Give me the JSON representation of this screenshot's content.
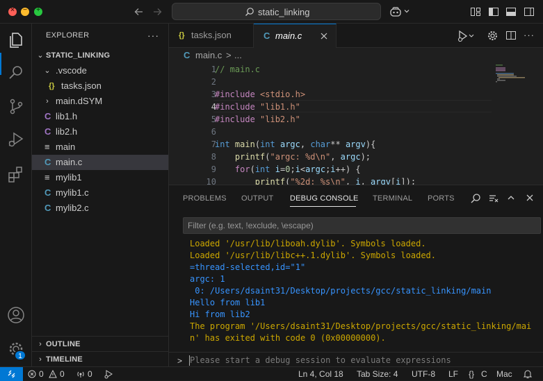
{
  "titlebar": {
    "search_text": "static_linking"
  },
  "sidebar": {
    "title": "EXPLORER",
    "more": "···",
    "workspace": "STATIC_LINKING",
    "tree": [
      {
        "label": ".vscode",
        "type": "folder-open",
        "icon": ""
      },
      {
        "label": "tasks.json",
        "type": "json",
        "icon": "{}"
      },
      {
        "label": "main.dSYM",
        "type": "folder",
        "icon": ""
      },
      {
        "label": "lib1.h",
        "type": "c",
        "icon": "C"
      },
      {
        "label": "lib2.h",
        "type": "c",
        "icon": "C"
      },
      {
        "label": "main",
        "type": "text",
        "icon": "≡"
      },
      {
        "label": "main.c",
        "type": "c",
        "icon": "C",
        "selected": true
      },
      {
        "label": "mylib1",
        "type": "text",
        "icon": "≡"
      },
      {
        "label": "mylib1.c",
        "type": "c",
        "icon": "C"
      },
      {
        "label": "mylib2.c",
        "type": "c",
        "icon": "C"
      }
    ],
    "outline": "OUTLINE",
    "timeline": "TIMELINE"
  },
  "activity": {
    "badge": "1"
  },
  "tabs": [
    {
      "label": "tasks.json",
      "icon": "{}",
      "active": false
    },
    {
      "label": "main.c",
      "icon": "C",
      "active": true
    }
  ],
  "breadcrumb": {
    "file": "main.c",
    "sep": ">",
    "more": "..."
  },
  "editor": {
    "line_numbers": [
      "1",
      "2",
      "3",
      "4",
      "5",
      "6",
      "7",
      "8",
      "9",
      "10"
    ],
    "current_line": "4"
  },
  "panel": {
    "tabs": [
      "PROBLEMS",
      "OUTPUT",
      "DEBUG CONSOLE",
      "TERMINAL",
      "PORTS"
    ],
    "active_tab": "DEBUG CONSOLE",
    "filter_placeholder": "Filter (e.g. text, !exclude, \\escape)",
    "console": [
      {
        "text": "Loaded '/usr/lib/liboah.dylib'. Symbols loaded.",
        "color": "yellow"
      },
      {
        "text": "Loaded '/usr/lib/libc++.1.dylib'. Symbols loaded.",
        "color": "yellow"
      },
      {
        "text": "=thread-selected,id=\"1\"",
        "color": "blue"
      },
      {
        "text": "argc: 1",
        "color": "blue"
      },
      {
        "text": " 0: /Users/dsaint31/Desktop/projects/gcc/static_linking/main",
        "color": "blue"
      },
      {
        "text": "Hello from lib1",
        "color": "blue"
      },
      {
        "text": "Hi from lib2",
        "color": "blue"
      },
      {
        "text": "The program '/Users/dsaint31/Desktop/projects/gcc/static_linking/mai",
        "color": "yellow"
      },
      {
        "text": "n' has exited with code 0 (0x00000000).",
        "color": "yellow"
      }
    ],
    "repl_prompt": ">",
    "repl_placeholder": "Please start a debug session to evaluate expressions"
  },
  "statusbar": {
    "errors": "0",
    "warnings": "0",
    "ports": "0",
    "position": "Ln 4, Col 18",
    "tab_size": "Tab Size: 4",
    "encoding": "UTF-8",
    "eol": "LF",
    "language": "C",
    "platform": "Mac"
  }
}
